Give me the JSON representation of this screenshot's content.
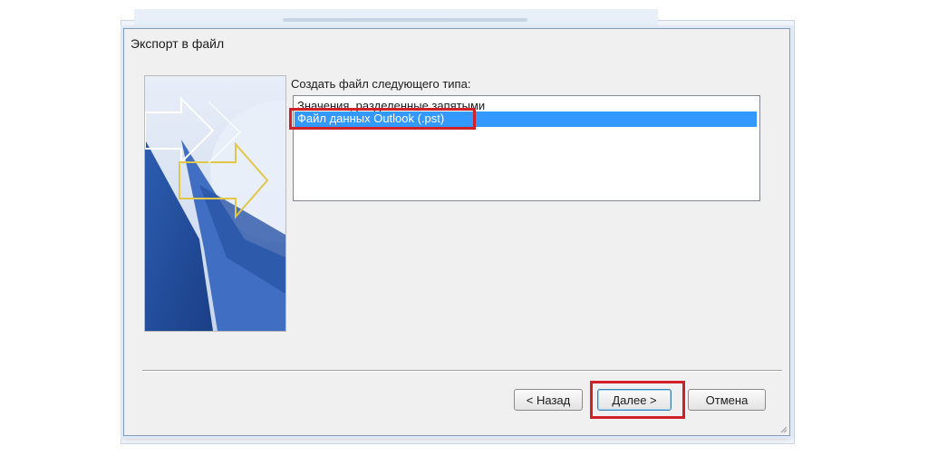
{
  "dialog": {
    "title": "Экспорт в файл",
    "prompt": "Создать файл следующего типа:",
    "file_types": [
      "Значения, разделенные запятыми",
      "Файл данных Outlook (.pst)"
    ],
    "selected_index": 1
  },
  "buttons": {
    "back": "< Назад",
    "next": "Далее >",
    "cancel": "Отмена"
  },
  "colors": {
    "selection": "#3399ff",
    "highlight_frame": "#d0202a"
  }
}
